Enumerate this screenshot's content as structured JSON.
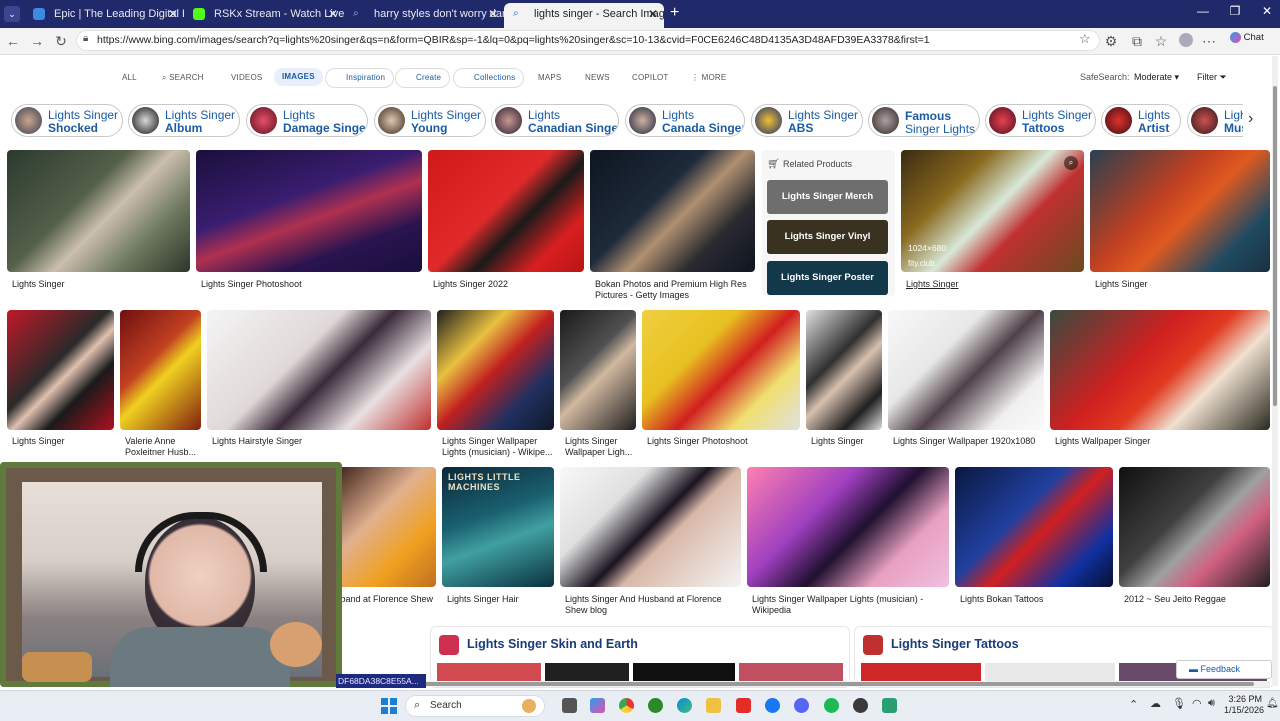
{
  "browser": {
    "tabs": [
      {
        "title": "Epic | The Leading Digital Library f"
      },
      {
        "title": "RSKx Stream - Watch Live on Kick"
      },
      {
        "title": "harry styles don't worry darling - S"
      },
      {
        "title": "lights singer - Search Images"
      }
    ],
    "url": "https://www.bing.com/images/search?q=lights%20singer&qs=n&form=QBIR&sp=-1&lq=0&pq=lights%20singer&sc=10-13&cvid=F0CE6246C48D4135A3D48AFD39EA3378&first=1",
    "chat_label": "Chat"
  },
  "scope": {
    "items": [
      "ALL",
      "SEARCH",
      "VIDEOS",
      "IMAGES",
      "Inspiration",
      "Create",
      "Collections",
      "MAPS",
      "NEWS",
      "COPILOT",
      "MORE"
    ],
    "safesearch_label": "SafeSearch:",
    "safesearch_value": "Moderate",
    "filter_label": "Filter"
  },
  "chips": [
    {
      "l1": "Lights Singer",
      "l2": "Shocked"
    },
    {
      "l1": "Lights Singer",
      "l2": "Album"
    },
    {
      "l1": "Lights",
      "l2": "Damage Singer"
    },
    {
      "l1": "Lights Singer",
      "l2": "Young"
    },
    {
      "l1": "Lights",
      "l2": "Canadian Singer"
    },
    {
      "l1": "Lights",
      "l2": "Canada Singer"
    },
    {
      "l1": "Lights Singer",
      "l2": "ABS"
    },
    {
      "l1": "Famous",
      "l2": "Singer Lights"
    },
    {
      "l1": "Lights Singer",
      "l2": "Tattoos"
    },
    {
      "l1": "Lights",
      "l2": "Artist"
    },
    {
      "l1": "Ligh",
      "l2": "Mus"
    }
  ],
  "row1": [
    {
      "caption": "Lights Singer"
    },
    {
      "caption": "Lights Singer Photoshoot"
    },
    {
      "caption": "Lights Singer 2022"
    },
    {
      "caption": "Bokan Photos and Premium High Res Pictures - Getty Images"
    },
    {
      "caption": "Lights Singer",
      "size": "1024×680",
      "source": "fity.club"
    },
    {
      "caption": "Lights Singer"
    }
  ],
  "related": {
    "title": "Related Products",
    "items": [
      "Lights Singer Merch",
      "Lights Singer Vinyl",
      "Lights Singer Poster"
    ]
  },
  "row2": [
    {
      "caption": "Lights Singer"
    },
    {
      "caption": "Valerie Anne Poxleitner Husb..."
    },
    {
      "caption": "Lights Hairstyle Singer"
    },
    {
      "caption": "Lights Singer Wallpaper Lights (musician) - Wikipe..."
    },
    {
      "caption": "Lights Singer Wallpaper Ligh..."
    },
    {
      "caption": "Lights Singer Photoshoot"
    },
    {
      "caption": "Lights Singer"
    },
    {
      "caption": "Lights Singer Wallpaper 1920x1080"
    },
    {
      "caption": "Lights Wallpaper Singer"
    }
  ],
  "row3": [
    {
      "caption": "sband at Florence Shew"
    },
    {
      "caption": "Lights Singer Hair",
      "overlay": "LIGHTS LITTLE MACHINES"
    },
    {
      "caption": "Lights Singer And Husband at Florence Shew blog"
    },
    {
      "caption": "Lights Singer Wallpaper Lights (musician) - Wikipedia"
    },
    {
      "caption": "Lights Bokan Tattoos"
    },
    {
      "caption": "2012 ~ Seu Jeito Reggae"
    }
  ],
  "cards": [
    {
      "title": "Lights Singer Skin and Earth"
    },
    {
      "title": "Lights Singer Tattoos"
    }
  ],
  "feedback_label": "Feedback",
  "overlay_hash": "DF68DA38C8E55A...",
  "taskbar": {
    "search_label": "Search",
    "time": "3:26 PM",
    "date": "1/15/2026"
  }
}
